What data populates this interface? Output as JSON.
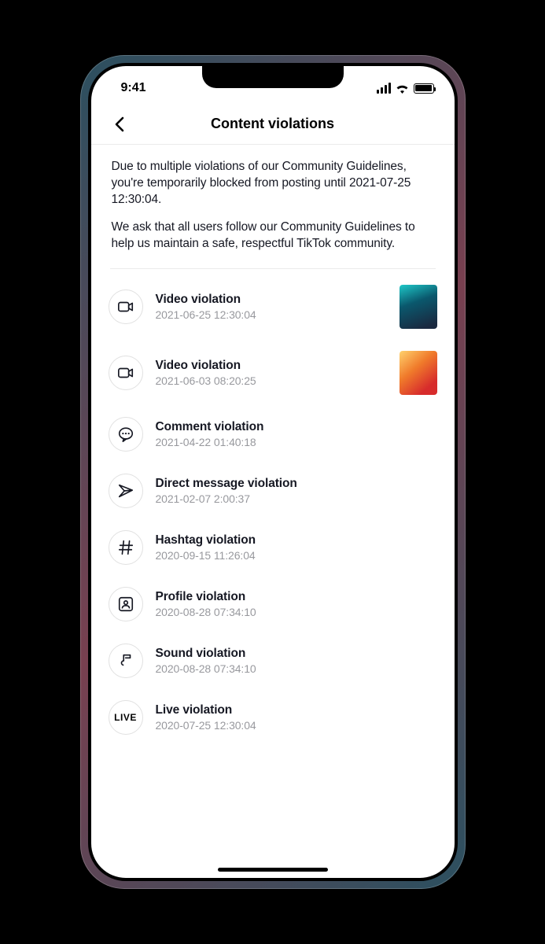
{
  "status": {
    "time": "9:41"
  },
  "nav": {
    "title": "Content violations"
  },
  "notice": {
    "p1": "Due to multiple violations of our Community Guidelines, you're temporarily blocked from posting until 2021-07-25 12:30:04.",
    "p2": "We ask that all users follow our Community Guidelines to help us maintain a safe, respectful TikTok community."
  },
  "items": [
    {
      "icon": "video",
      "title": "Video violation",
      "date": "2021-06-25 12:30:04",
      "thumb": "thumb-1"
    },
    {
      "icon": "video",
      "title": "Video violation",
      "date": "2021-06-03 08:20:25",
      "thumb": "thumb-2"
    },
    {
      "icon": "comment",
      "title": "Comment violation",
      "date": "2021-04-22 01:40:18"
    },
    {
      "icon": "send",
      "title": "Direct message violation",
      "date": "2021-02-07 2:00:37"
    },
    {
      "icon": "hashtag",
      "title": "Hashtag violation",
      "date": "2020-09-15 11:26:04"
    },
    {
      "icon": "profile",
      "title": "Profile violation",
      "date": "2020-08-28 07:34:10"
    },
    {
      "icon": "sound",
      "title": "Sound violation",
      "date": "2020-08-28 07:34:10"
    },
    {
      "icon": "live",
      "title": "Live violation",
      "date": "2020-07-25 12:30:04"
    }
  ],
  "live_label": "LIVE"
}
